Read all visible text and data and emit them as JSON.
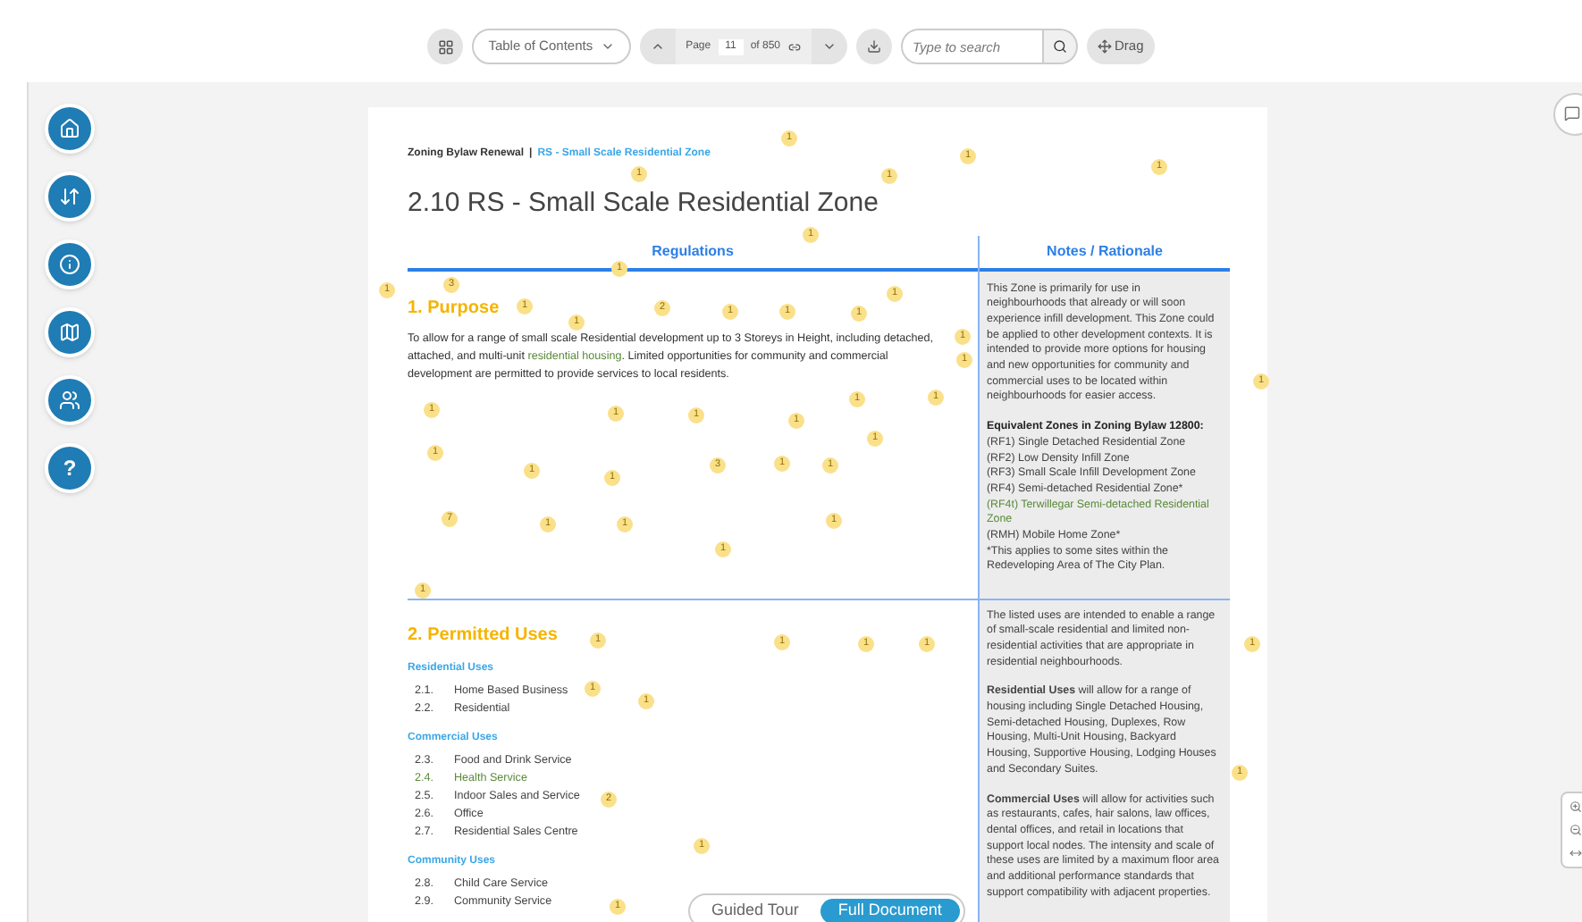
{
  "toolbar": {
    "toc_label": "Table of Contents",
    "page_label": "Page",
    "page_value": "11",
    "page_total": "of 850",
    "search_placeholder": "Type to search",
    "drag_label": "Drag"
  },
  "sidebar": {
    "help_label": "?"
  },
  "breadcrumb": {
    "parent": "Zoning Bylaw Renewal",
    "separator": "|",
    "current": "RS - Small Scale Residential Zone"
  },
  "title": "2.10 RS - Small Scale Residential Zone",
  "columns": [
    "Regulations",
    "Notes / Rationale"
  ],
  "purpose": {
    "heading": "1. Purpose",
    "body": [
      {
        "kind": "plain",
        "text": "To allow for a range of small scale Residential development up to 3 Storeys in Height, including detached, attached, and multi-unit "
      },
      {
        "kind": "link",
        "text": "residential housing"
      },
      {
        "kind": "plain",
        "text": ". Limited opportunities for community and commercial development are permitted to provide services to local residents."
      }
    ],
    "notes": [
      {
        "kind": "paragraph",
        "text": "This Zone is primarily for use in neighbourhoods that already or will soon experience infill development. This Zone could be applied to other development contexts. It is intended to provide more options for housing and new opportunities for community and commercial uses to be located within neighbourhoods for easier access."
      },
      {
        "kind": "heading",
        "text": "Equivalent Zones in Zoning Bylaw 12800:"
      },
      {
        "kind": "line",
        "text": "(RF1) Single Detached Residential Zone"
      },
      {
        "kind": "line",
        "text": "(RF2) Low Density Infill Zone"
      },
      {
        "kind": "line",
        "text": "(RF3) Small Scale Infill Development Zone"
      },
      {
        "kind": "line",
        "text": "(RF4) Semi-detached Residential Zone*"
      },
      {
        "kind": "link",
        "text": "(RF4t) Terwillegar Semi-detached Residential Zone"
      },
      {
        "kind": "line",
        "text": "(RMH) Mobile Home Zone*"
      },
      {
        "kind": "line",
        "text": "*This applies to some sites within the Redeveloping Area of The City Plan."
      }
    ]
  },
  "permitted": {
    "heading": "2. Permitted Uses",
    "groups": [
      {
        "label": "Residential Uses",
        "items": [
          {
            "number": "2.1.",
            "name": "Home Based Business",
            "kind": "plain"
          },
          {
            "number": "2.2.",
            "name": "Residential",
            "kind": "plain"
          }
        ]
      },
      {
        "label": "Commercial Uses",
        "items": [
          {
            "number": "2.3.",
            "name": "Food and Drink Service",
            "kind": "plain"
          },
          {
            "number": "2.4.",
            "name": "Health Service",
            "kind": "link"
          },
          {
            "number": "2.5.",
            "name": "Indoor Sales and Service",
            "kind": "plain"
          },
          {
            "number": "2.6.",
            "name": "Office",
            "kind": "plain"
          },
          {
            "number": "2.7.",
            "name": "Residential Sales Centre",
            "kind": "plain"
          }
        ]
      },
      {
        "label": "Community Uses",
        "items": [
          {
            "number": "2.8.",
            "name": "Child Care Service",
            "kind": "plain"
          },
          {
            "number": "2.9.",
            "name": "Community Service",
            "kind": "plain"
          }
        ]
      }
    ],
    "notes": [
      "The listed uses are intended to enable a range of small-scale residential and limited non-residential activities that are appropriate in residential neighbourhoods.",
      "**Residential Uses** will allow for a range of housing including Single Detached Housing, Semi-detached Housing, Duplexes, Row Housing, Multi-Unit Housing, Backyard Housing, Supportive Housing, Lodging Houses and Secondary Suites.",
      "**Commercial Uses** will allow for activities such as restaurants, cafes, hair salons, law offices, dental offices, and retail in locations that support local nodes.  The intensity and scale of these uses are limited by a maximum floor area and additional performance standards that support compatibility with adjacent properties."
    ]
  },
  "view_toggle": [
    {
      "label": "Guided Tour",
      "selected": false
    },
    {
      "label": "Full Document",
      "selected": true
    }
  ],
  "comment_markers": [
    "1",
    "1",
    "1",
    "1",
    "1",
    "1",
    "1",
    "1",
    "1",
    "3",
    "1",
    "2",
    "1",
    "1",
    "1",
    "1",
    "1",
    "1",
    "1",
    "1",
    "1",
    "1",
    "1",
    "1",
    "1",
    "1",
    "1",
    "1",
    "1",
    "3",
    "1",
    "1",
    "7",
    "1",
    "1",
    "1",
    "1",
    "1",
    "1",
    "1",
    "1",
    "1",
    "1",
    "1",
    "2",
    "1",
    "1",
    "1",
    "1"
  ]
}
